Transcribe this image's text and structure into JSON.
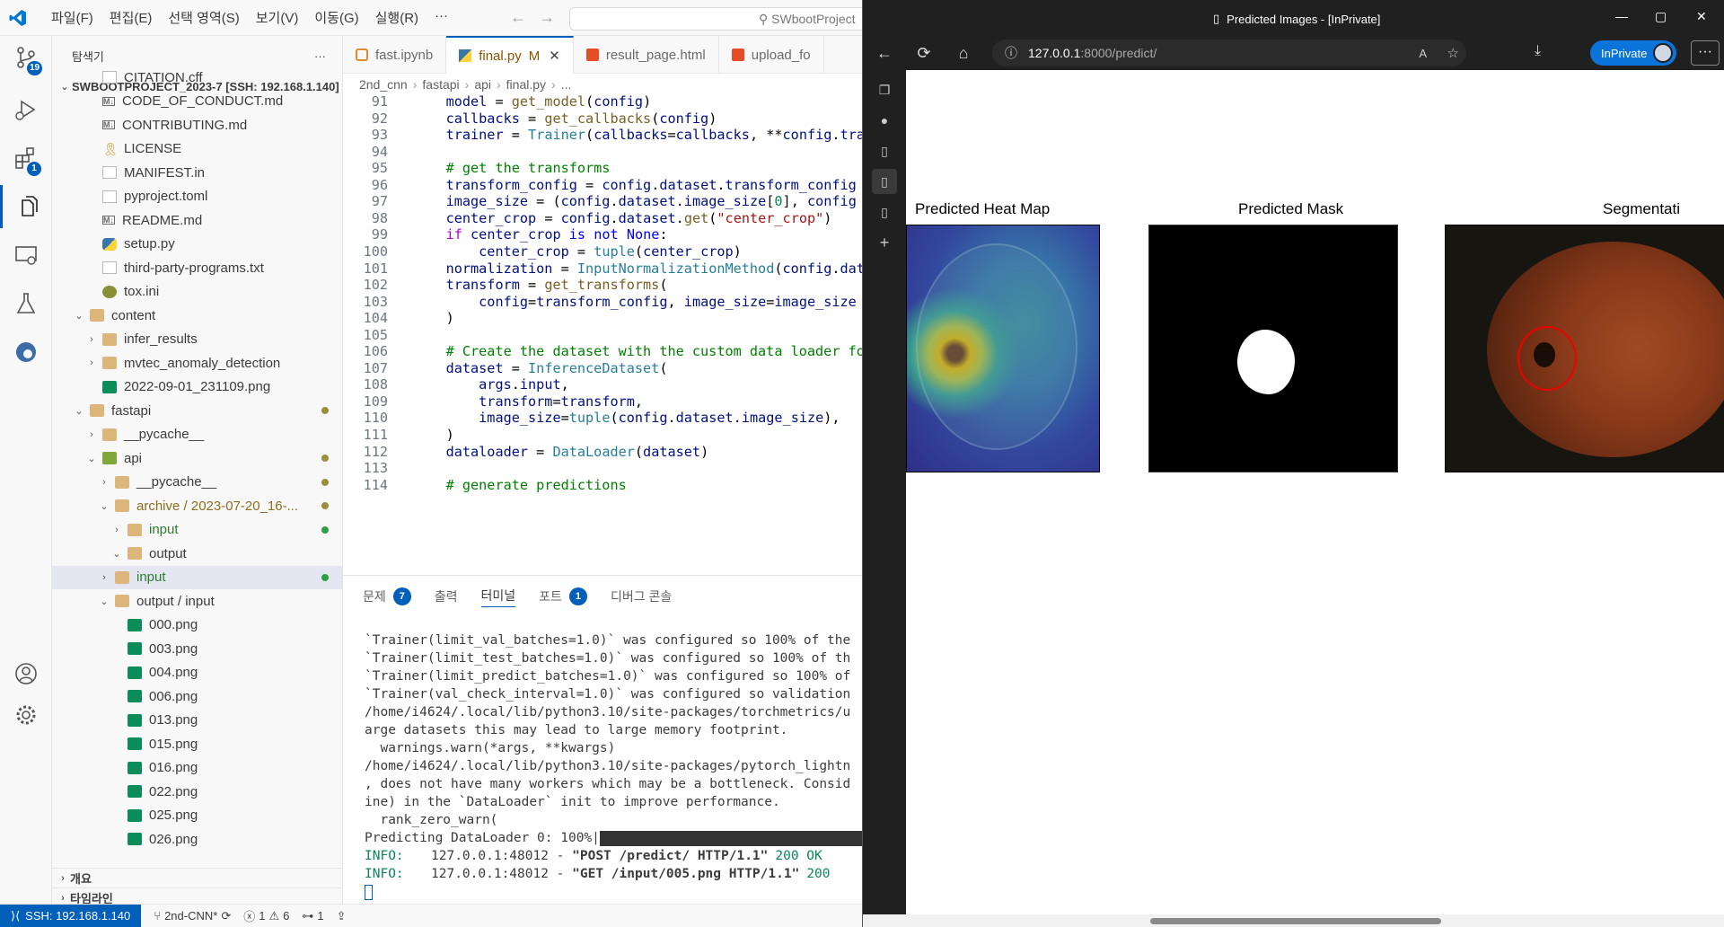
{
  "vscode": {
    "menu": [
      "파일(F)",
      "편집(E)",
      "선택 영역(S)",
      "보기(V)",
      "이동(G)",
      "실행(R)",
      "···"
    ],
    "search_placeholder": "SWbootProject",
    "activity_badges": {
      "source_control": "19",
      "extensions": "1"
    },
    "explorer": {
      "title": "탐색기",
      "more": "···",
      "root": "SWBOOTPROJECT_2023-7 [SSH: 192.168.1.140]",
      "items": [
        {
          "label": "CITATION.cff",
          "icon": "text-file-icon",
          "indent": 1
        },
        {
          "label": "CODE_OF_CONDUCT.md",
          "icon": "markdown-icon",
          "indent": 1
        },
        {
          "label": "CONTRIBUTING.md",
          "icon": "markdown-icon",
          "indent": 1
        },
        {
          "label": "LICENSE",
          "icon": "license-icon",
          "indent": 1
        },
        {
          "label": "MANIFEST.in",
          "icon": "text-file-icon",
          "indent": 1
        },
        {
          "label": "pyproject.toml",
          "icon": "text-file-icon",
          "indent": 1
        },
        {
          "label": "README.md",
          "icon": "markdown-icon",
          "indent": 1
        },
        {
          "label": "setup.py",
          "icon": "python-icon",
          "indent": 1
        },
        {
          "label": "third-party-programs.txt",
          "icon": "text-file-icon",
          "indent": 1
        },
        {
          "label": "tox.ini",
          "icon": "gear-file-icon",
          "indent": 1
        },
        {
          "label": "content",
          "icon": "folder-open-icon",
          "chevron": "open",
          "indent": 0
        },
        {
          "label": "infer_results",
          "icon": "folder-icon",
          "chevron": "closed",
          "indent": 1
        },
        {
          "label": "mvtec_anomaly_detection",
          "icon": "folder-icon",
          "chevron": "closed",
          "indent": 1
        },
        {
          "label": "2022-09-01_231109.png",
          "icon": "image-icon",
          "indent": 1
        },
        {
          "label": "fastapi",
          "icon": "folder-open-icon",
          "chevron": "open",
          "indent": 0,
          "dot": true
        },
        {
          "label": "__pycache__",
          "icon": "folder-icon",
          "chevron": "closed",
          "indent": 1
        },
        {
          "label": "api",
          "icon": "folder-api-icon",
          "chevron": "open",
          "indent": 1,
          "dot": true
        },
        {
          "label": "__pycache__",
          "icon": "folder-icon",
          "chevron": "closed",
          "indent": 2,
          "dot": true
        },
        {
          "label": "archive / 2023-07-20_16-...",
          "icon": "folder-open-icon",
          "chevron": "open",
          "indent": 2,
          "dot": true,
          "color": "#8a6d1f"
        },
        {
          "label": "input",
          "icon": "folder-icon",
          "chevron": "closed",
          "indent": 3,
          "dot": true,
          "green": true,
          "color": "#2e7d32"
        },
        {
          "label": "output",
          "icon": "folder-open-icon",
          "chevron": "open",
          "indent": 3
        },
        {
          "label": "input",
          "icon": "folder-icon",
          "chevron": "closed",
          "indent": 2,
          "dot": true,
          "green": true,
          "selected": true,
          "color": "#2e7d32"
        },
        {
          "label": "output / input",
          "icon": "folder-open-icon",
          "chevron": "open",
          "indent": 2
        },
        {
          "label": "000.png",
          "icon": "image-icon",
          "indent": 3
        },
        {
          "label": "003.png",
          "icon": "image-icon",
          "indent": 3
        },
        {
          "label": "004.png",
          "icon": "image-icon",
          "indent": 3
        },
        {
          "label": "006.png",
          "icon": "image-icon",
          "indent": 3
        },
        {
          "label": "013.png",
          "icon": "image-icon",
          "indent": 3
        },
        {
          "label": "015.png",
          "icon": "image-icon",
          "indent": 3
        },
        {
          "label": "016.png",
          "icon": "image-icon",
          "indent": 3
        },
        {
          "label": "022.png",
          "icon": "image-icon",
          "indent": 3
        },
        {
          "label": "025.png",
          "icon": "image-icon",
          "indent": 3
        },
        {
          "label": "026.png",
          "icon": "image-icon",
          "indent": 3
        }
      ],
      "outline": "개요",
      "timeline": "타임라인"
    },
    "tabs": [
      {
        "label": "fast.ipynb",
        "icon": "notebook-icon",
        "active": false
      },
      {
        "label": "final.py",
        "icon": "python-icon",
        "active": true,
        "modified": "M"
      },
      {
        "label": "result_page.html",
        "icon": "html-icon",
        "active": false
      },
      {
        "label": "upload_fo",
        "icon": "html-icon",
        "active": false
      }
    ],
    "breadcrumb": [
      "2nd_cnn",
      "fastapi",
      "api",
      "final.py",
      "..."
    ],
    "code": [
      {
        "n": "91",
        "html": "    <span class='v'>model</span> = <span class='f'>get_model</span>(<span class='v'>config</span>)"
      },
      {
        "n": "92",
        "html": "    <span class='v'>callbacks</span> = <span class='f'>get_callbacks</span>(<span class='v'>config</span>)"
      },
      {
        "n": "93",
        "html": "    <span class='v'>trainer</span> = <span class='t'>Trainer</span>(<span class='v'>callbacks</span>=<span class='v'>callbacks</span>, **<span class='v'>config</span>.<span class='v'>trainer</span>)"
      },
      {
        "n": "94",
        "html": ""
      },
      {
        "n": "95",
        "html": "    <span class='c'># get the transforms</span>"
      },
      {
        "n": "96",
        "html": "    <span class='v'>transform_config</span> = <span class='v'>config</span>.<span class='v'>dataset</span>.<span class='v'>transform_config</span>"
      },
      {
        "n": "97",
        "html": "    <span class='v'>image_size</span> = (<span class='v'>config</span>.<span class='v'>dataset</span>.<span class='v'>image_size</span>[<span class='n'>0</span>], <span class='v'>config</span>"
      },
      {
        "n": "98",
        "html": "    <span class='v'>center_crop</span> = <span class='v'>config</span>.<span class='v'>dataset</span>.<span class='f'>get</span>(<span class='s'>\"center_crop\"</span>)"
      },
      {
        "n": "99",
        "html": "    <span class='k'>if</span> <span class='v'>center_crop</span> <span class='b'>is not</span> <span class='b'>None</span>:"
      },
      {
        "n": "100",
        "html": "        <span class='v'>center_crop</span> = <span class='t'>tuple</span>(<span class='v'>center_crop</span>)"
      },
      {
        "n": "101",
        "html": "    <span class='v'>normalization</span> = <span class='t'>InputNormalizationMethod</span>(<span class='v'>config</span>.<span class='v'>dataset</span>"
      },
      {
        "n": "102",
        "html": "    <span class='v'>transform</span> = <span class='f'>get_transforms</span>("
      },
      {
        "n": "103",
        "html": "        <span class='v'>config</span>=<span class='v'>transform_config</span>, <span class='v'>image_size</span>=<span class='v'>image_size</span>"
      },
      {
        "n": "104",
        "html": "    )"
      },
      {
        "n": "105",
        "html": ""
      },
      {
        "n": "106",
        "html": "    <span class='c'># Create the dataset with the custom data loader for</span>"
      },
      {
        "n": "107",
        "html": "    <span class='v'>dataset</span> = <span class='t'>InferenceDataset</span>("
      },
      {
        "n": "108",
        "html": "        <span class='v'>args</span>.<span class='v'>input</span>,"
      },
      {
        "n": "109",
        "html": "        <span class='v'>transform</span>=<span class='v'>transform</span>,"
      },
      {
        "n": "110",
        "html": "        <span class='v'>image_size</span>=<span class='t'>tuple</span>(<span class='v'>config</span>.<span class='v'>dataset</span>.<span class='v'>image_size</span>),"
      },
      {
        "n": "111",
        "html": "    )"
      },
      {
        "n": "112",
        "html": "    <span class='v'>dataloader</span> = <span class='t'>DataLoader</span>(<span class='v'>dataset</span>)"
      },
      {
        "n": "113",
        "html": ""
      },
      {
        "n": "114",
        "html": "    <span class='c'># generate predictions</span>"
      }
    ],
    "panel_tabs": [
      {
        "label": "문제",
        "badge": "7"
      },
      {
        "label": "출력"
      },
      {
        "label": "터미널",
        "active": true
      },
      {
        "label": "포트",
        "badge": "1"
      },
      {
        "label": "디버그 콘솔"
      }
    ],
    "terminal": [
      "`Trainer(limit_val_batches=1.0)` was configured so 100% of the",
      "`Trainer(limit_test_batches=1.0)` was configured so 100% of th",
      "`Trainer(limit_predict_batches=1.0)` was configured so 100% of",
      "`Trainer(val_check_interval=1.0)` was configured so validation",
      "/home/i4624/.local/lib/python3.10/site-packages/torchmetrics/u",
      "arge datasets this may lead to large memory footprint.",
      "  warnings.warn(*args, **kwargs)",
      "/home/i4624/.local/lib/python3.10/site-packages/pytorch_lightn",
      ", does not have many workers which may be a bottleneck. Consid",
      "ine) in the `DataLoader` init to improve performance.",
      "  rank_zero_warn("
    ],
    "predicting": "Predicting DataLoader 0: 100%|",
    "progress": 1.0,
    "info_lines": [
      {
        "prefix": "INFO:",
        "addr": "127.0.0.1:48012 - ",
        "req": "\"POST /predict/ HTTP/1.1\"",
        "code": "200 OK"
      },
      {
        "prefix": "INFO:",
        "addr": "127.0.0.1:48012 - ",
        "req": "\"GET /input/005.png HTTP/1.1\"",
        "code": "200"
      }
    ],
    "status": {
      "remote": "SSH: 192.168.1.140",
      "branch": "2nd-CNN*",
      "errors": "1",
      "warnings": "6",
      "ports": "1"
    }
  },
  "browser": {
    "title": "Predicted Images - [InPrivate]",
    "url_host": "127.0.0.1",
    "url_path": ":8000/predict/",
    "inprivate": "InPrivate",
    "panels": [
      {
        "title": "Predicted Heat Map"
      },
      {
        "title": "Predicted Mask"
      },
      {
        "title": "Segmentati"
      }
    ]
  },
  "colors": {
    "accent": "#005fb8",
    "inprivate": "#0a74da"
  }
}
